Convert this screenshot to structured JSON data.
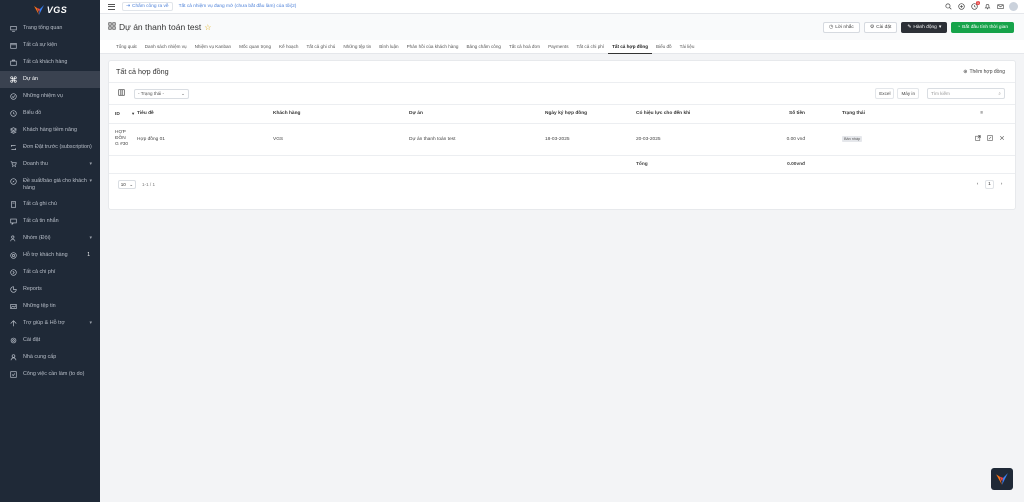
{
  "brand": {
    "name": "VGS"
  },
  "sidebar": {
    "items": [
      {
        "label": "Trang tổng quan",
        "icon": "dashboard-icon"
      },
      {
        "label": "Tất cả sự kiện",
        "icon": "calendar-icon"
      },
      {
        "label": "Tất cả khách hàng",
        "icon": "briefcase-icon"
      },
      {
        "label": "Dự án",
        "icon": "command-icon",
        "active": true
      },
      {
        "label": "Những nhiệm vụ",
        "icon": "check-circle-icon"
      },
      {
        "label": "Biểu đồ",
        "icon": "clock-icon"
      },
      {
        "label": "Khách hàng tiềm năng",
        "icon": "layers-icon"
      },
      {
        "label": "Đơn Đặt trước (subscription)",
        "icon": "repeat-icon"
      },
      {
        "label": "Doanh thu",
        "icon": "cart-icon",
        "caret": "▾"
      },
      {
        "label": "Đề suất/báo giá cho khách hàng",
        "icon": "compass-icon",
        "caret": "▾"
      },
      {
        "label": "Tất cả ghi chú",
        "icon": "book-icon"
      },
      {
        "label": "Tất cả tin nhắn",
        "icon": "message-icon"
      },
      {
        "label": "Nhóm (Đội)",
        "icon": "users-icon",
        "caret": "▾"
      },
      {
        "label": "Hỗ trợ khách hàng",
        "icon": "lifebuoy-icon",
        "badge": "1"
      },
      {
        "label": "Tất cả chi phí",
        "icon": "arrow-circle-icon"
      },
      {
        "label": "Reports",
        "icon": "pie-chart-icon"
      },
      {
        "label": "Những tệp tin",
        "icon": "image-icon"
      },
      {
        "label": "Trợ giúp & Hỗ trợ",
        "icon": "help-icon",
        "caret": "▾"
      },
      {
        "label": "Cài đặt",
        "icon": "settings-icon"
      },
      {
        "label": "Nhà cung cấp",
        "icon": "user-icon"
      },
      {
        "label": "Công việc cần làm (to do)",
        "icon": "checkbox-icon"
      }
    ]
  },
  "topbar": {
    "timecard_label": "Chấm công ra về",
    "task_notice": "Tất cả nhiệm vụ đang mở (chưa bắt đầu làm) của tôi(2)",
    "notification_count": "1"
  },
  "header": {
    "title": "Dự án thanh toán test",
    "reminder_label": "Lời nhắc",
    "settings_label": "Cài đặt",
    "actions_label": "Hành động",
    "timer_label": "Bắt đầu tính thời gian"
  },
  "tabs": [
    {
      "label": "Tổng quát"
    },
    {
      "label": "Danh sách nhiệm vụ"
    },
    {
      "label": "Nhiệm vụ Kanban"
    },
    {
      "label": "Mốc quan trọng"
    },
    {
      "label": "Kế hoạch"
    },
    {
      "label": "Tất cả ghi chú"
    },
    {
      "label": "Những tệp tin"
    },
    {
      "label": "Bình luận"
    },
    {
      "label": "Phản hồi của khách hàng"
    },
    {
      "label": "Bảng chấm công"
    },
    {
      "label": "Tất cả hoá đơn"
    },
    {
      "label": "Payments"
    },
    {
      "label": "Tất cả chi phí"
    },
    {
      "label": "Tất cả hợp đồng",
      "active": true
    },
    {
      "label": "Biểu đồ"
    },
    {
      "label": "Tài liệu"
    }
  ],
  "card": {
    "title": "Tất cả hợp đồng",
    "add_label": "Thêm hợp đồng",
    "status_filter": "- Trạng thái -",
    "excel_label": "Excel",
    "print_label": "Máy in",
    "search_placeholder": "Tìm kiếm"
  },
  "table": {
    "columns": [
      "ID",
      "Tiêu đề",
      "Khách hàng",
      "Dự án",
      "Ngày ký hợp đồng",
      "Có hiệu lực cho đến khi",
      "Số tiền",
      "Trạng thái"
    ],
    "rows": [
      {
        "id": "HỢP ĐỒNG #30",
        "title": "Hợp đồng 01",
        "client": "VGS",
        "project": "Dự án thanh toán test",
        "signed": "18-03-2025",
        "valid_until": "20-03-2025",
        "amount": "0.00 vnđ",
        "status": "Bản nháp"
      }
    ],
    "total_label": "Tổng",
    "total_amount": "0.00vnđ"
  },
  "pager": {
    "page_size": "10",
    "range": "1-1 / 1",
    "current_page": "1"
  }
}
